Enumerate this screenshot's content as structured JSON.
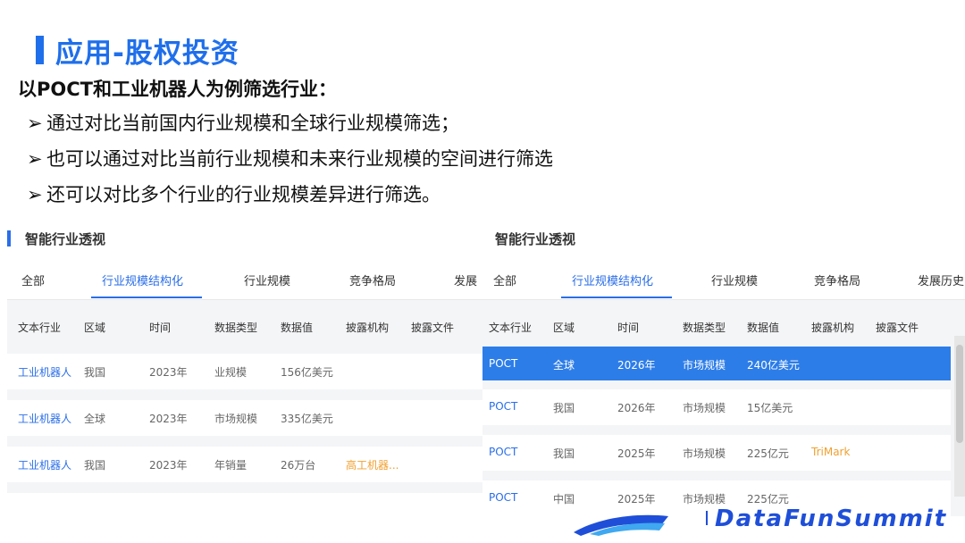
{
  "slide": {
    "title": "应用-股权投资",
    "subtitle": "以POCT和工业机器人为例筛选行业：",
    "bullets": [
      {
        "mark": "➢",
        "text": "通过对比当前国内行业规模和全球行业规模筛选；"
      },
      {
        "mark": "➢",
        "text": "也可以通过对比当前行业规模和未来行业规模的空间进行筛选"
      },
      {
        "mark": "➢",
        "text": "还可以对比多个行业的行业规模差异进行筛选。"
      }
    ]
  },
  "left_panel": {
    "title": "智能行业透视",
    "tabs": [
      "全部",
      "行业规模结构化",
      "行业规模",
      "竞争格局",
      "发展"
    ],
    "active_tab": 1,
    "columns": [
      "文本行业",
      "区域",
      "时间",
      "数据类型",
      "数据值",
      "披露机构",
      "披露文件"
    ],
    "rows": [
      [
        "工业机器人",
        "我国",
        "2023年",
        "业规模",
        "156亿美元",
        "",
        ""
      ],
      [
        "工业机器人",
        "全球",
        "2023年",
        "市场规模",
        "335亿美元",
        "",
        ""
      ],
      [
        "工业机器人",
        "我国",
        "2023年",
        "年销量",
        "26万台",
        "高工机器...",
        ""
      ]
    ]
  },
  "right_panel": {
    "title": "智能行业透视",
    "tabs": [
      "全部",
      "行业规模结构化",
      "行业规模",
      "竞争格局",
      "发展历史"
    ],
    "active_tab": 1,
    "columns": [
      "文本行业",
      "区域",
      "时间",
      "数据类型",
      "数据值",
      "披露机构",
      "披露文件"
    ],
    "rows": [
      [
        "POCT",
        "全球",
        "2026年",
        "市场规模",
        "240亿美元",
        "",
        ""
      ],
      [
        "POCT",
        "我国",
        "2026年",
        "市场规模",
        "15亿美元",
        "",
        ""
      ],
      [
        "POCT",
        "我国",
        "2025年",
        "市场规模",
        "225亿元",
        "TriMark",
        ""
      ],
      [
        "POCT",
        "中国",
        "2025年",
        "市场规模",
        "225亿元",
        "",
        ""
      ]
    ],
    "selected_row": 0
  },
  "logo": {
    "text": "DataFunSummit"
  },
  "colors": {
    "accent": "#1f6feb",
    "link": "#2a6ee8",
    "selected_row": "#2d7de8",
    "org_text": "#f0a030"
  }
}
